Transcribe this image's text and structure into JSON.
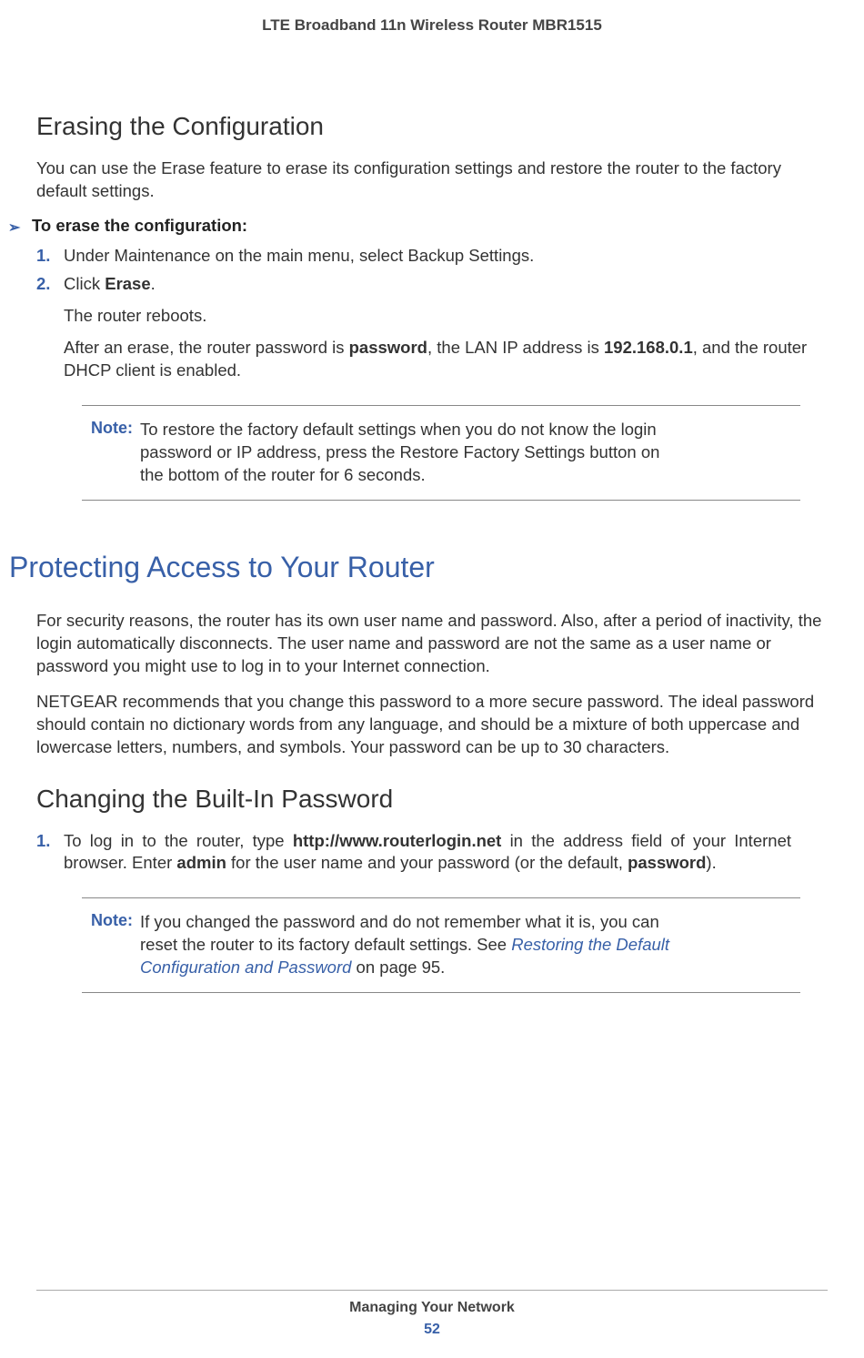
{
  "header": {
    "title": "LTE Broadband 11n Wireless Router MBR1515"
  },
  "section1": {
    "heading": "Erasing the Configuration",
    "intro": "You can use the Erase feature to erase its configuration settings and restore the router to the factory default settings.",
    "proc_heading": "To erase the configuration:",
    "step1": "Under Maintenance on the main menu, select Backup Settings.",
    "step2_prefix": "Click ",
    "step2_bold": "Erase",
    "step2_suffix": ".",
    "reboot": "The router reboots.",
    "after_erase_1": "After an erase, the router password is ",
    "after_erase_pw": "password",
    "after_erase_2": ", the LAN IP address is ",
    "after_erase_ip": "192.168.0.1",
    "after_erase_3": ", and the router DHCP client is enabled.",
    "note_label": "Note:",
    "note_text": "To restore the factory default settings when you do not know the login password or IP address, press the Restore Factory Settings button on the bottom of the router for 6 seconds."
  },
  "section2": {
    "heading": "Protecting Access to Your Router",
    "para1": "For security reasons, the router has its own user name and password. Also, after a period of inactivity, the login automatically disconnects. The user name and password are not the same as a user name or password you might use to log in to your Internet connection.",
    "para2": "NETGEAR recommends that you change this password to a more secure password. The ideal password should contain no dictionary words from any language, and should be a mixture of both uppercase and lowercase letters, numbers, and symbols. Your password can be up to 30 characters.",
    "sub_heading": "Changing the Built-In Password",
    "step1_a": "To log in to the router, type ",
    "step1_url": "http://www.routerlogin.net",
    "step1_b": " in the address field of your Internet browser. Enter ",
    "step1_admin": "admin",
    "step1_c": " for the user name and your password (or the default, ",
    "step1_pw": "password",
    "step1_d": ").",
    "note_label": "Note:",
    "note_a": "If you changed the password and do not remember what it is, you can reset the router to its factory default settings. See ",
    "note_link": "Restoring the Default Configuration and Password",
    "note_b": " on page 95."
  },
  "footer": {
    "title": "Managing Your Network",
    "page": "52"
  },
  "numbers": {
    "one": "1.",
    "two": "2."
  },
  "arrow": "➢"
}
